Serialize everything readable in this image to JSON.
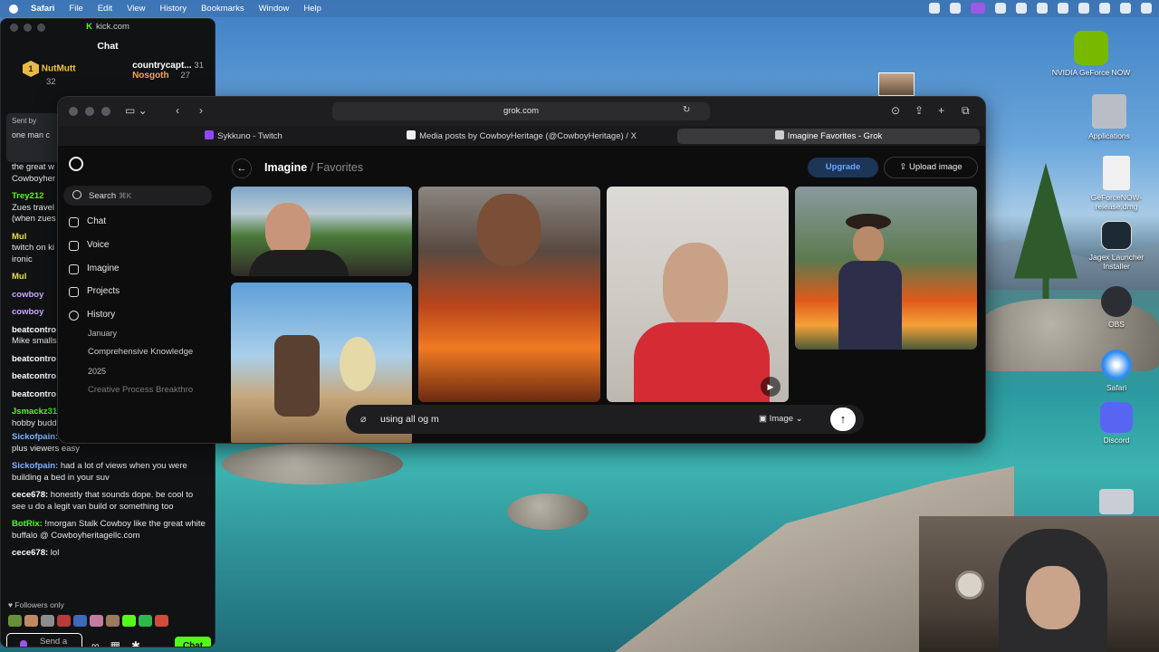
{
  "menubar": {
    "items": [
      "Safari",
      "File",
      "Edit",
      "View",
      "History",
      "Bookmarks",
      "Window",
      "Help"
    ]
  },
  "kick": {
    "url": "kick.com",
    "chat_title": "Chat",
    "leader1": {
      "name": "NutMutt",
      "count": "32",
      "rank": "1"
    },
    "leader2": {
      "name": "countrycapt...",
      "count": "31"
    },
    "leader3": {
      "name": "Nosgoth",
      "count": "27"
    },
    "pinned": {
      "label": "Sent by",
      "text": "one man c"
    },
    "messages": [
      {
        "user": "",
        "text": "the great w",
        "tail": "Cowboyher"
      },
      {
        "user": "Trey212",
        "text": "Zues travel",
        "tail": "(when zues"
      },
      {
        "user": "Mul",
        "text": "twitch on ki",
        "tail": "ironic"
      },
      {
        "user": "Mul",
        "text": ""
      },
      {
        "user": "cowboy",
        "text": ""
      },
      {
        "user": "cowboy",
        "text": ""
      },
      {
        "user": "beatcontro",
        "text": "Mike smalls"
      },
      {
        "user": "beatcontro",
        "text": ""
      },
      {
        "user": "beatcontro",
        "text": ""
      },
      {
        "user": "beatcontro",
        "text": ""
      },
      {
        "user": "Jsmackz31",
        "text": "hobby budd"
      }
    ],
    "lower_messages": [
      {
        "user": "Sickofpain:",
        "text": "plus viewers easy"
      },
      {
        "user": "Sickofpain:",
        "text": "had a lot of views when you were building a bed in your suv"
      },
      {
        "user": "cece678:",
        "text": "honestly that sounds dope. be cool to see u do a legit van build or something too"
      },
      {
        "user": "BotRix:",
        "text": "!morgan Stalk Cowboy like the great white buffalo @ Cowboyheritagellc.com"
      },
      {
        "user": "cece678:",
        "text": "lol"
      }
    ],
    "followers_only": "Followers only",
    "input_placeholder": "Send a message",
    "send_label": "Chat"
  },
  "safari": {
    "address": "grok.com",
    "tabs": [
      "Sykkuno - Twitch",
      "Media posts by CowboyHeritage (@CowboyHeritage) / X",
      "Imagine Favorites - Grok"
    ]
  },
  "grok": {
    "search": "Search",
    "search_kbd": "⌘K",
    "nav": [
      "Chat",
      "Voice",
      "Imagine",
      "Projects",
      "History"
    ],
    "history": {
      "month": "January",
      "item1": "Comprehensive Knowledge",
      "year": "2025",
      "item2": "Creative Process Breakthro"
    },
    "breadcrumb_main": "Imagine",
    "breadcrumb_sep": "/",
    "breadcrumb_sub": "Favorites",
    "upgrade": "Upgrade",
    "upload": "Upload image",
    "prompt_text": "using all og m",
    "mode": "Image"
  },
  "desktop": {
    "icons": [
      "NVIDIA GeForce NOW",
      "Applications",
      "GeForceNOW-release.dmg",
      "Jagex Launcher Installer",
      "OBS",
      "Safari",
      "Discord"
    ]
  },
  "colors": {
    "kick_green": "#53fc18",
    "grok_upgrade": "#6fa8ff"
  }
}
